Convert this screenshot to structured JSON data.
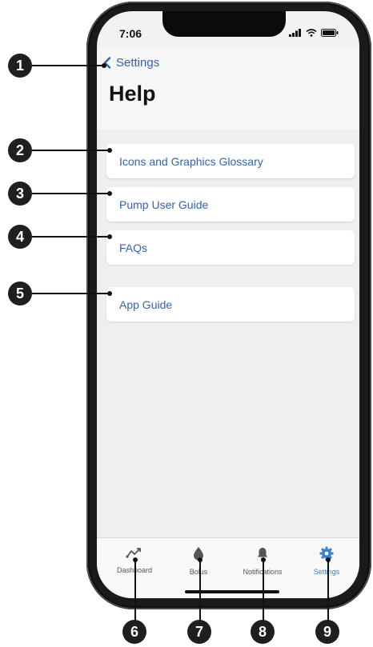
{
  "status_bar": {
    "time": "7:06"
  },
  "nav": {
    "back_label": "Settings",
    "title": "Help"
  },
  "menu_items": [
    {
      "label": "Icons and Graphics Glossary"
    },
    {
      "label": "Pump User Guide"
    },
    {
      "label": "FAQs"
    },
    {
      "label": "App Guide"
    }
  ],
  "tab_bar": {
    "tabs": [
      {
        "label": "Dashboard",
        "icon": "dashboard-trend-icon"
      },
      {
        "label": "Bolus",
        "icon": "drop-icon"
      },
      {
        "label": "Notifications",
        "icon": "bell-icon"
      },
      {
        "label": "Settings",
        "icon": "gear-icon",
        "active": true
      }
    ],
    "active_color": "#3d7fd0"
  },
  "callouts": [
    "1",
    "2",
    "3",
    "4",
    "5",
    "6",
    "7",
    "8",
    "9"
  ],
  "colors": {
    "link": "#3563a8",
    "background": "#efefef",
    "callout": "#1f1f1f"
  }
}
